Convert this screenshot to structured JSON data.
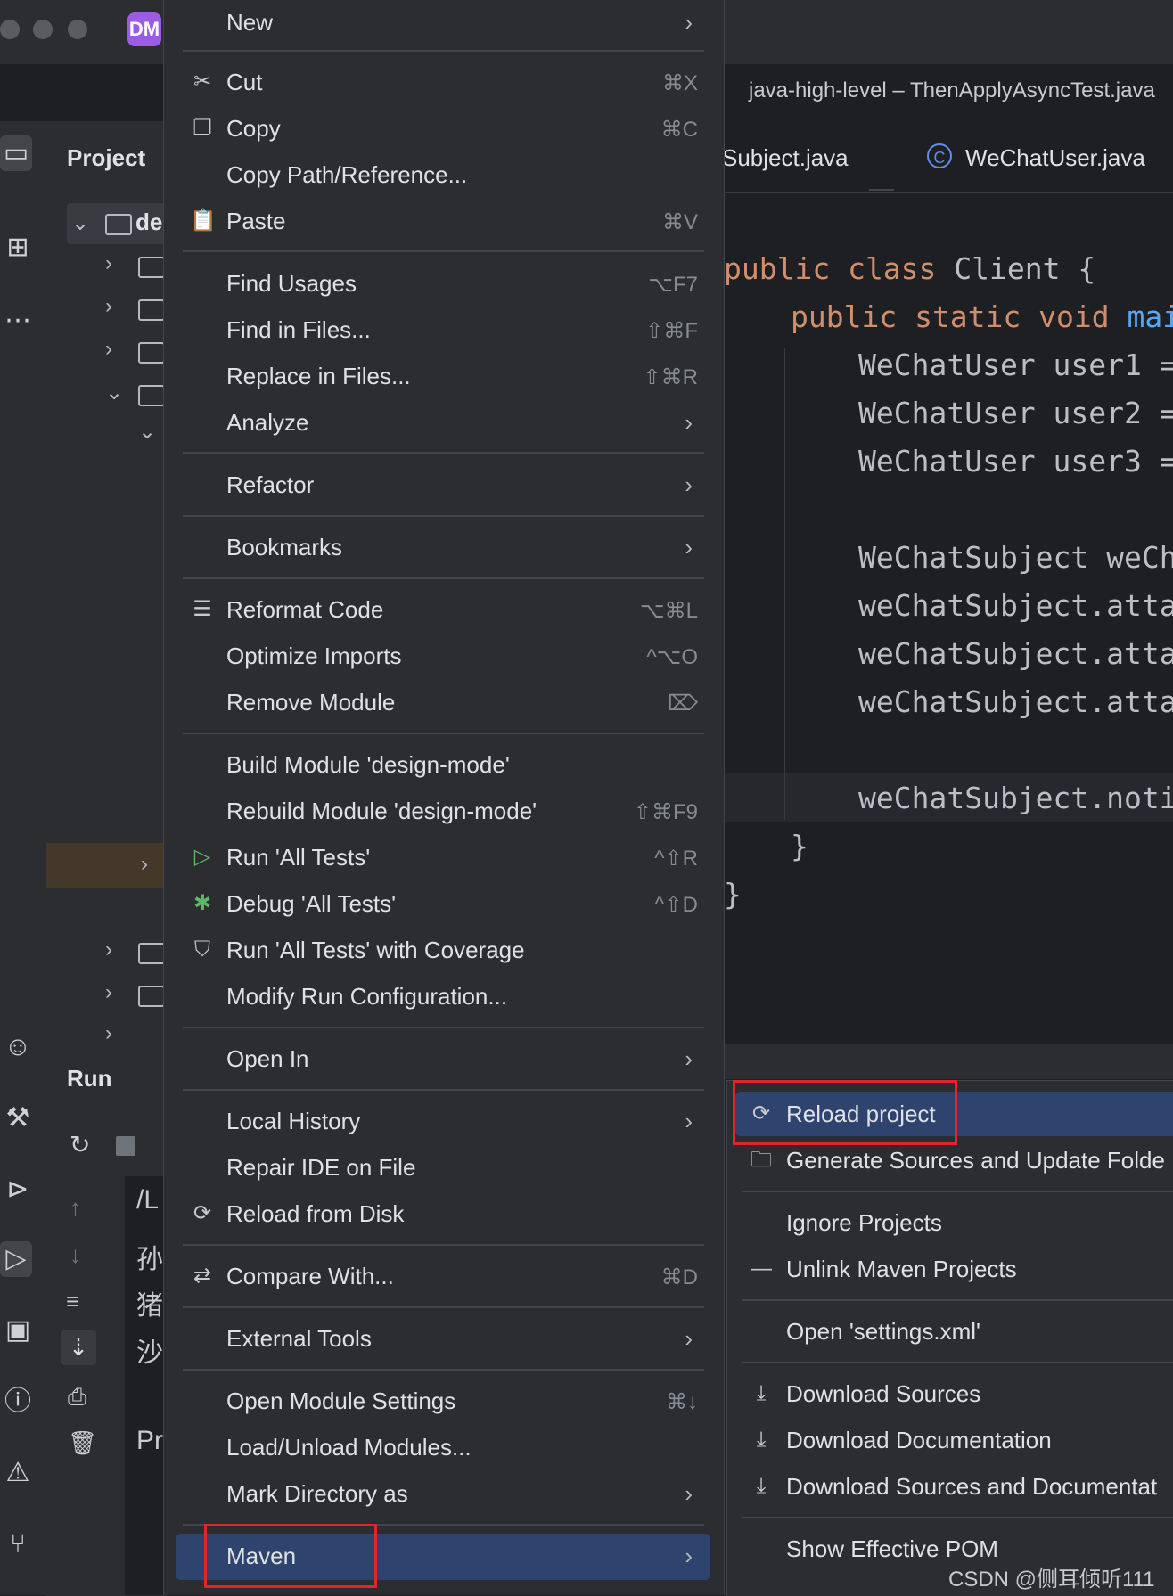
{
  "titlebar": {
    "project_badge": "DM",
    "window_title": "java-high-level – ThenApplyAsyncTest.java"
  },
  "project_panel": {
    "title": "Project",
    "root_label": "de"
  },
  "run_panel": {
    "title": "Run",
    "console_lines": [
      "/L",
      "孙",
      "猪",
      "沙",
      "Pr"
    ]
  },
  "editor": {
    "tabs": [
      "Subject.java",
      "WeChatUser.java"
    ],
    "tab_class_icon": "C",
    "code": {
      "l1_kw": "public class",
      "l1_rest": " Client {",
      "l2_kw": "public static void",
      "l2_fn": " mai",
      "l3": "WeChatUser user1 =",
      "l4": "WeChatUser user2 =",
      "l5": "WeChatUser user3 =",
      "l6": "WeChatSubject weCha",
      "l7": "weChatSubject.attac",
      "l8": "weChatSubject.attac",
      "l9": "weChatSubject.attac",
      "l10": "weChatSubject.noti",
      "l11": "}",
      "l12": "}"
    }
  },
  "context_menu": {
    "new": "New",
    "cut": "Cut",
    "cut_sc": "⌘X",
    "copy": "Copy",
    "copy_sc": "⌘C",
    "copy_path": "Copy Path/Reference...",
    "paste": "Paste",
    "paste_sc": "⌘V",
    "find_usages": "Find Usages",
    "find_usages_sc": "⌥F7",
    "find_in_files": "Find in Files...",
    "find_in_files_sc": "⇧⌘F",
    "replace_in_files": "Replace in Files...",
    "replace_in_files_sc": "⇧⌘R",
    "analyze": "Analyze",
    "refactor": "Refactor",
    "bookmarks": "Bookmarks",
    "reformat_code": "Reformat Code",
    "reformat_code_sc": "⌥⌘L",
    "optimize_imports": "Optimize Imports",
    "optimize_imports_sc": "^⌥O",
    "remove_module": "Remove Module",
    "remove_module_sc": "⌦",
    "build_module": "Build Module 'design-mode'",
    "rebuild_module": "Rebuild Module 'design-mode'",
    "rebuild_module_sc": "⇧⌘F9",
    "run_all": "Run 'All Tests'",
    "run_all_sc": "^⇧R",
    "debug_all": "Debug 'All Tests'",
    "debug_all_sc": "^⇧D",
    "run_coverage": "Run 'All Tests' with Coverage",
    "modify_run": "Modify Run Configuration...",
    "open_in": "Open In",
    "local_history": "Local History",
    "repair_ide": "Repair IDE on File",
    "reload_disk": "Reload from Disk",
    "compare_with": "Compare With...",
    "compare_with_sc": "⌘D",
    "external_tools": "External Tools",
    "open_module_settings": "Open Module Settings",
    "open_module_settings_sc": "⌘↓",
    "load_unload": "Load/Unload Modules...",
    "mark_directory": "Mark Directory as",
    "maven": "Maven"
  },
  "maven_submenu": {
    "reload_project": "Reload project",
    "generate_sources": "Generate Sources and Update Folde",
    "ignore_projects": "Ignore Projects",
    "unlink": "Unlink Maven Projects",
    "open_settings": "Open 'settings.xml'",
    "download_sources": "Download Sources",
    "download_docs": "Download Documentation",
    "download_both": "Download Sources and Documentat",
    "show_pom": "Show Effective POM"
  },
  "colors": {
    "selection": "#2e436e",
    "highlight_box": "#e0262a",
    "menu_bg": "#2b2d30",
    "editor_bg": "#1e1f22"
  },
  "watermark": "CSDN @侧耳倾听111"
}
